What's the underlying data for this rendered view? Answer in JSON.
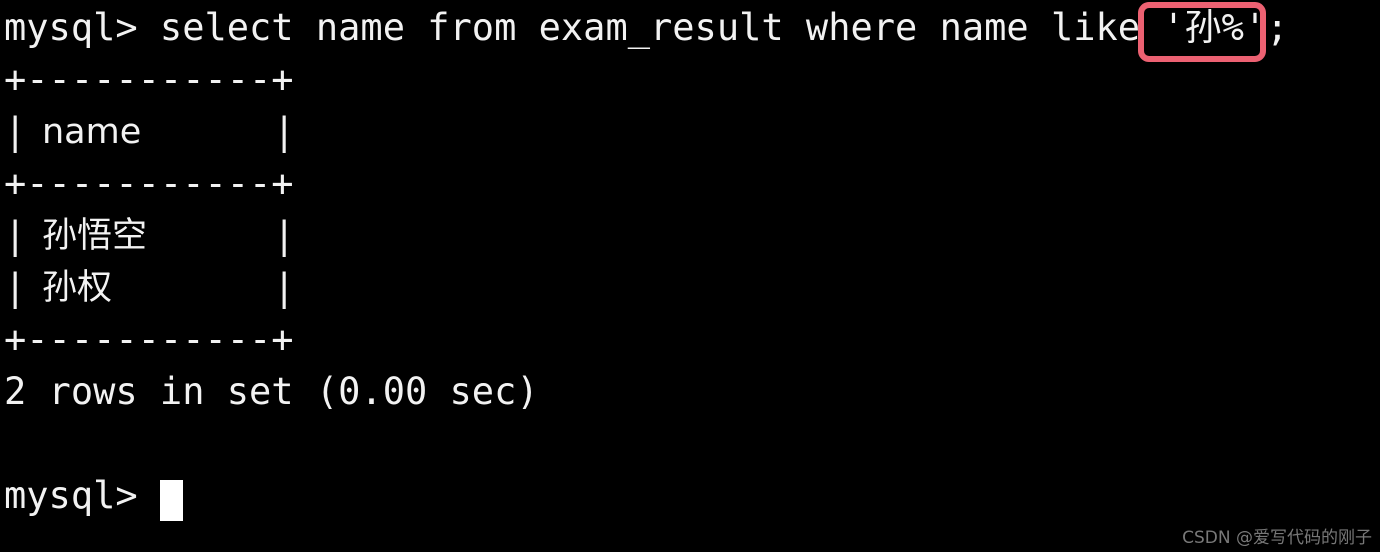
{
  "terminal": {
    "title": "MySQL command line client",
    "background_color": "#000000",
    "foreground_color": "#f2f2f2",
    "prompt": "mysql>",
    "command_line": "mysql> select name from exam_result where name like '孙%';",
    "command": "select name from exam_result where name like '孙%';",
    "like_pattern": "'孙%'",
    "lines": [
      "mysql> select name from exam_result where name like '孙%';",
      "+-----------+",
      "| name      |",
      "+-----------+",
      "| 孙悟空    |",
      "| 孙权      |",
      "+-----------+",
      "2 rows in set (0.00 sec)",
      "",
      "mysql> "
    ],
    "separator": "+-----------+",
    "header_pipe_left": "|",
    "header_pipe_right": "|",
    "header_label": "name",
    "rows": [
      {
        "name": "孙悟空"
      },
      {
        "name": "孙权"
      }
    ],
    "status_line": "2 rows in set (0.00 sec)",
    "row_count": 2,
    "elapsed": "0.00 sec",
    "final_prompt": "mysql> ",
    "cursor": "block"
  },
  "annotation": {
    "highlight_color": "#ec6172",
    "highlight_target": "'孙%'",
    "shape": "rounded-rectangle"
  },
  "watermark": {
    "text": "CSDN @爱写代码的刚子",
    "color": "#8d8d8d"
  }
}
